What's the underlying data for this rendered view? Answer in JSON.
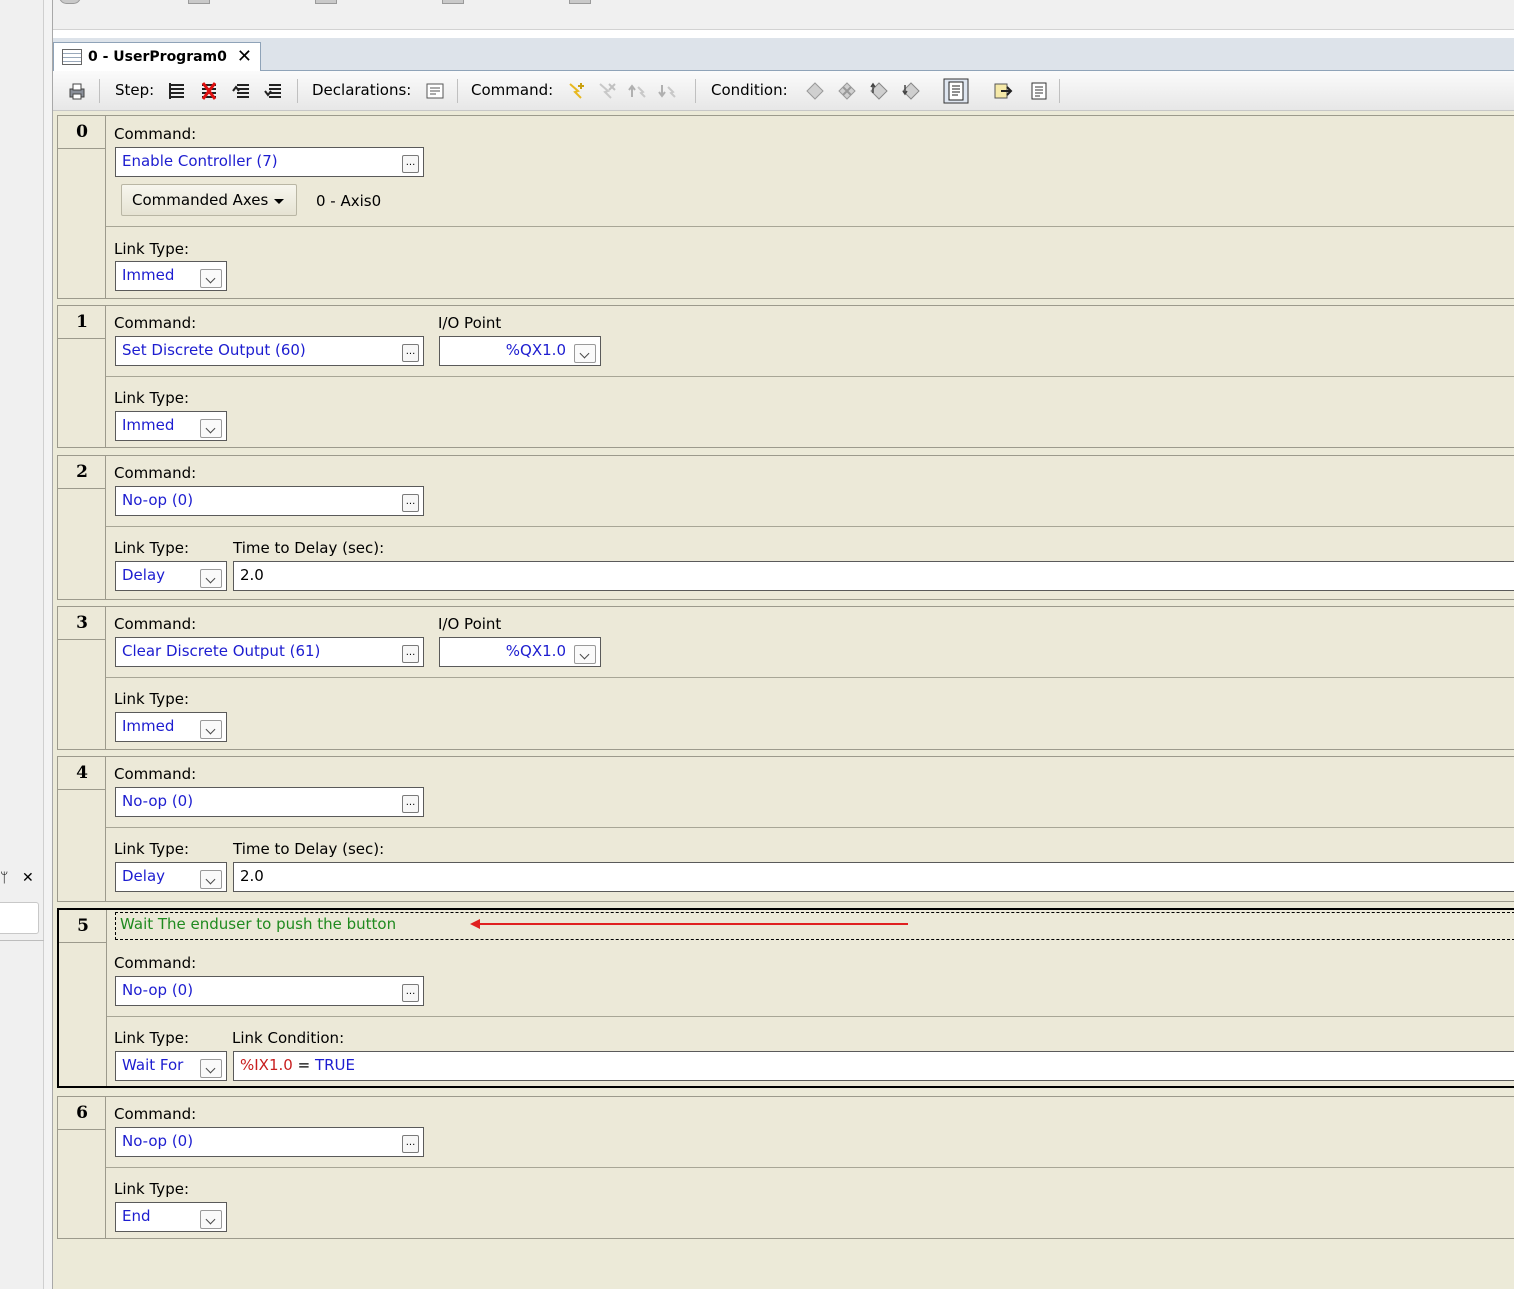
{
  "tab": {
    "title": "0 - UserProgram0",
    "close": "✕"
  },
  "toolbar": {
    "step_label": "Step:",
    "declarations_label": "Declarations:",
    "command_label": "Command:",
    "condition_label": "Condition:"
  },
  "left_panel": {
    "pin": "ᛘ",
    "close": "✕"
  },
  "labels": {
    "command": "Command:",
    "link_type": "Link Type:",
    "io_point": "I/O Point",
    "time_to_delay": "Time to Delay (sec):",
    "link_condition": "Link Condition:",
    "dots": "..."
  },
  "steps": [
    {
      "number": "0",
      "command": "Enable Controller (7)",
      "axes_label": "Commanded Axes",
      "axes_value": "0 - Axis0",
      "link_type": "Immed"
    },
    {
      "number": "1",
      "command": "Set Discrete Output (60)",
      "io_point": "%QX1.0",
      "link_type": "Immed"
    },
    {
      "number": "2",
      "command": "No-op (0)",
      "link_type": "Delay",
      "delay": "2.0"
    },
    {
      "number": "3",
      "command": "Clear Discrete Output (61)",
      "io_point": "%QX1.0",
      "link_type": "Immed"
    },
    {
      "number": "4",
      "command": "No-op (0)",
      "link_type": "Delay",
      "delay": "2.0"
    },
    {
      "number": "5",
      "comment": "Wait The enduser to push the button",
      "command": "No-op (0)",
      "link_type": "Wait For",
      "condition_var": "%IX1.0",
      "condition_op": "=",
      "condition_val": "TRUE"
    },
    {
      "number": "6",
      "command": "No-op (0)",
      "link_type": "End"
    }
  ],
  "colors": {
    "value_blue": "#1d1dd0",
    "comment_green": "#1f8a1f",
    "variable_red": "#c81e1e",
    "annotation_arrow": "#e02020"
  }
}
